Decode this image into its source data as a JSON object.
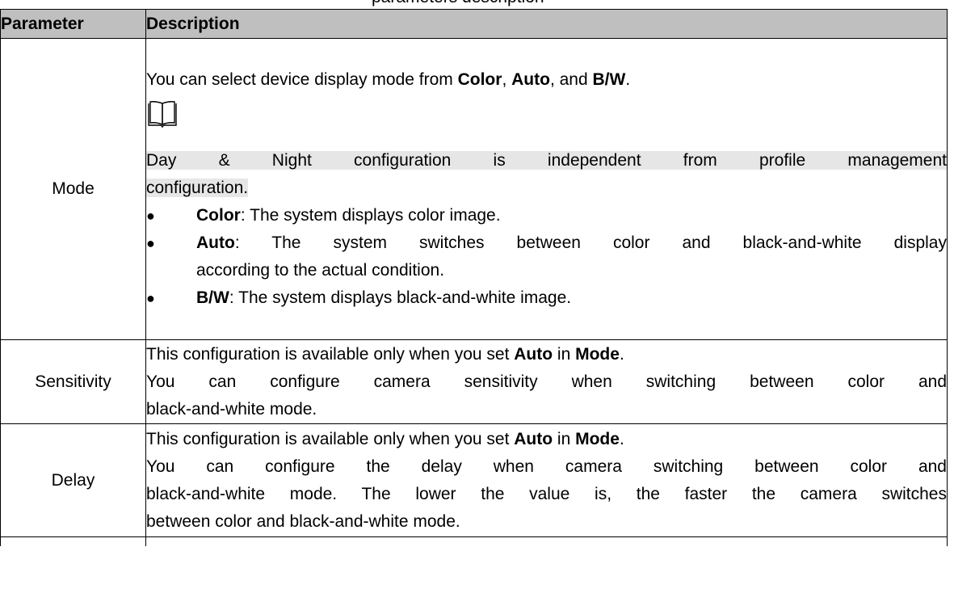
{
  "caption_fragment": "parameters description",
  "table": {
    "headers": {
      "parameter": "Parameter",
      "description": "Description"
    },
    "rows": {
      "mode": {
        "parameter": "Mode",
        "intro_prefix": "You can select device display mode from ",
        "opt_color": "Color",
        "sep1": ", ",
        "opt_auto": "Auto",
        "sep2": ", and ",
        "opt_bw": "B/W",
        "end": ".",
        "note_line1": "Day & Night configuration is independent from profile management",
        "note_line2": "configuration.",
        "bullets": {
          "color": {
            "term": "Color",
            "text": ": The system displays color image."
          },
          "auto": {
            "term": "Auto",
            "text_line1": ": The system switches between color and black-and-white display",
            "text_line2": "according to the actual condition."
          },
          "bw": {
            "term": "B/W",
            "text": ": The system displays black-and-white image."
          }
        }
      },
      "sensitivity": {
        "parameter": "Sensitivity",
        "avail_prefix": "This configuration is available only when you set ",
        "avail_auto": "Auto",
        "avail_in": " in ",
        "avail_mode": "Mode",
        "avail_end": ".",
        "desc_line1": "You can configure camera sensitivity when switching between color and",
        "desc_line2": "black-and-white mode."
      },
      "delay": {
        "parameter": "Delay",
        "avail_prefix": "This configuration is available only when you set ",
        "avail_auto": "Auto",
        "avail_in": " in ",
        "avail_mode": "Mode",
        "avail_end": ".",
        "desc_line1": "You can configure the delay when camera switching between color and",
        "desc_line2": "black-and-white mode. The lower the value is, the faster the camera switches",
        "desc_line3": "between color and black-and-white mode."
      }
    }
  },
  "icons": {
    "note": "open-book-note-icon"
  }
}
